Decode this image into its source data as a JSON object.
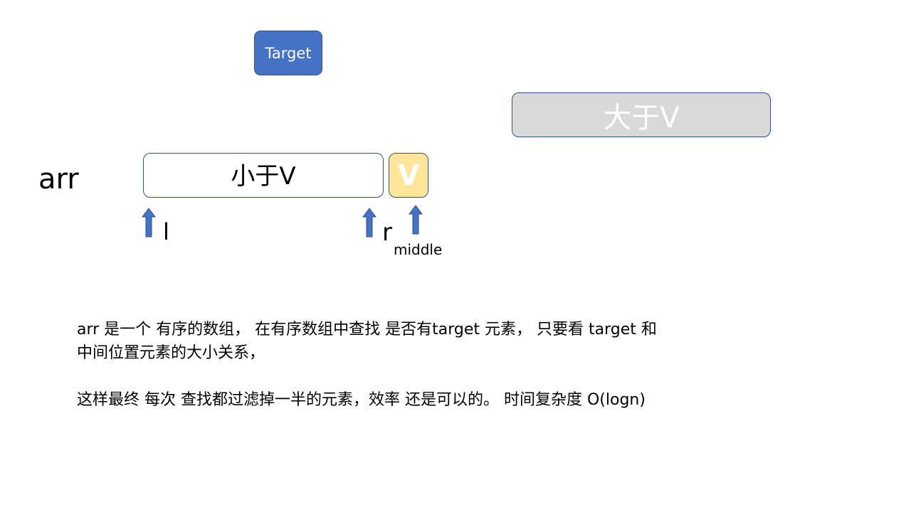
{
  "colors": {
    "target_fill": "#4472c4",
    "target_text": "#ffffff",
    "greater_fill": "#d9d9d9",
    "greater_text": "#ffffff",
    "less_fill": "#ffffff",
    "less_text": "#000000",
    "v_fill": "#ffe699",
    "v_text": "#ffffff",
    "outline": "#2f528f",
    "arrow_fill": "#4472c4",
    "arrow_stroke": "#2f528f"
  },
  "boxes": {
    "target": "Target",
    "greater": "大于V",
    "less": "小于V",
    "v": "V"
  },
  "labels": {
    "arr": "arr",
    "l": "l",
    "r": "r",
    "middle": "middle"
  },
  "arrows": [
    {
      "name": "arrow-l-icon",
      "direction": "up"
    },
    {
      "name": "arrow-r-icon",
      "direction": "up"
    },
    {
      "name": "arrow-middle-icon",
      "direction": "up"
    }
  ],
  "description": {
    "line1": "arr 是一个 有序的数组，  在有序数组中查找 是否有target  元素，  只要看 target 和",
    "line2": "中间位置元素的大小关系，",
    "line3": "这样最终 每次 查找都过滤掉一半的元素，效率 还是可以的。 时间复杂度  O(logn)"
  }
}
